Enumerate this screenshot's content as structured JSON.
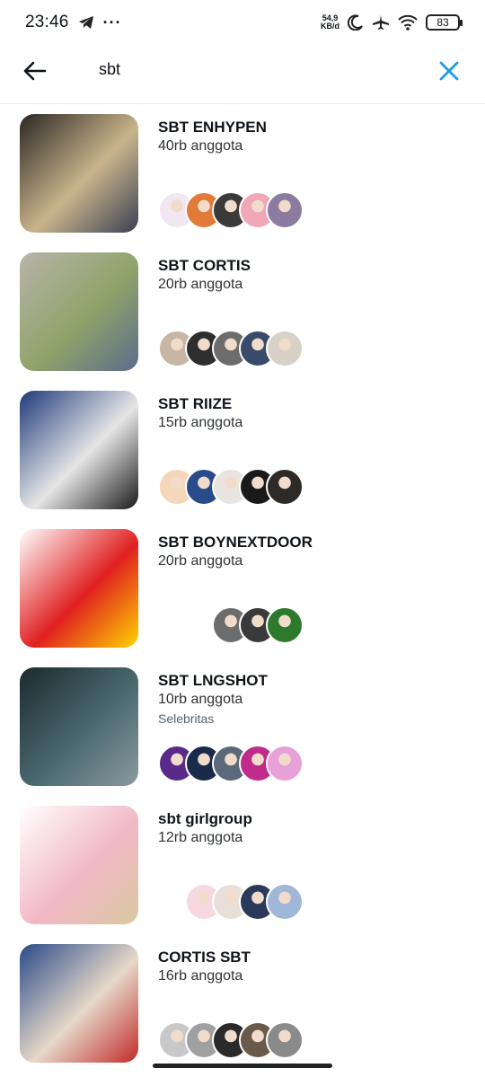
{
  "status_bar": {
    "time": "23:46",
    "net_speed_value": "54,9",
    "net_speed_unit": "KB/d",
    "battery": "83"
  },
  "search": {
    "query": "sbt"
  },
  "communities": [
    {
      "name": "SBT ENHYPEN",
      "members": "40rb anggota",
      "tag": "",
      "thumb_colors": [
        "#2a2622",
        "#c9b58c",
        "#3b3f52"
      ],
      "avatar_colors": [
        "#f2e6f0",
        "#e27a3a",
        "#3a3a3a",
        "#f0a8b8",
        "#8c7aa0"
      ]
    },
    {
      "name": "SBT CORTIS",
      "members": "20rb anggota",
      "tag": "",
      "thumb_colors": [
        "#b8b3a8",
        "#8fa36a",
        "#5d6c8a"
      ],
      "avatar_colors": [
        "#c7b6a4",
        "#2e2e2e",
        "#6c6c6c",
        "#3a4a6a",
        "#d8d1c8"
      ]
    },
    {
      "name": "SBT RIIZE",
      "members": "15rb anggota",
      "tag": "",
      "thumb_colors": [
        "#1e3a7a",
        "#e6e6e6",
        "#1a1a1a"
      ],
      "avatar_colors": [
        "#f3d7b8",
        "#2a4b8a",
        "#e8e4e0",
        "#1a1a1a",
        "#2e2a28"
      ]
    },
    {
      "name": "SBT BOYNEXTDOOR",
      "members": "20rb anggota",
      "tag": "",
      "thumb_colors": [
        "#ffffff",
        "#e02020",
        "#ffd400"
      ],
      "avatar_colors": [
        "#6c6c6c",
        "#3a3a3a",
        "#2d7a2d"
      ]
    },
    {
      "name": "SBT LNGSHOT",
      "members": "10rb anggota",
      "tag": "Selebritas",
      "thumb_colors": [
        "#1c2a2e",
        "#4a6a70",
        "#8a9aa0"
      ],
      "avatar_colors": [
        "#5a2a8a",
        "#1a2a4a",
        "#5a6a7a",
        "#c02a8a",
        "#e8a0d8"
      ]
    },
    {
      "name": "sbt girlgroup",
      "members": "12rb anggota",
      "tag": "",
      "thumb_colors": [
        "#ffffff",
        "#f2b8c6",
        "#d8c8a0"
      ],
      "avatar_colors": [
        "#f8d8e0",
        "#e8e0d8",
        "#2a3a5a",
        "#a0b8d8"
      ]
    },
    {
      "name": "CORTIS SBT",
      "members": "16rb anggota",
      "tag": "",
      "thumb_colors": [
        "#2a4a8a",
        "#e6d8c8",
        "#c02a2a"
      ],
      "avatar_colors": [
        "#c8c8c8",
        "#a0a0a0",
        "#2a2a2a",
        "#6a5a4a",
        "#8a8a8a"
      ]
    }
  ]
}
